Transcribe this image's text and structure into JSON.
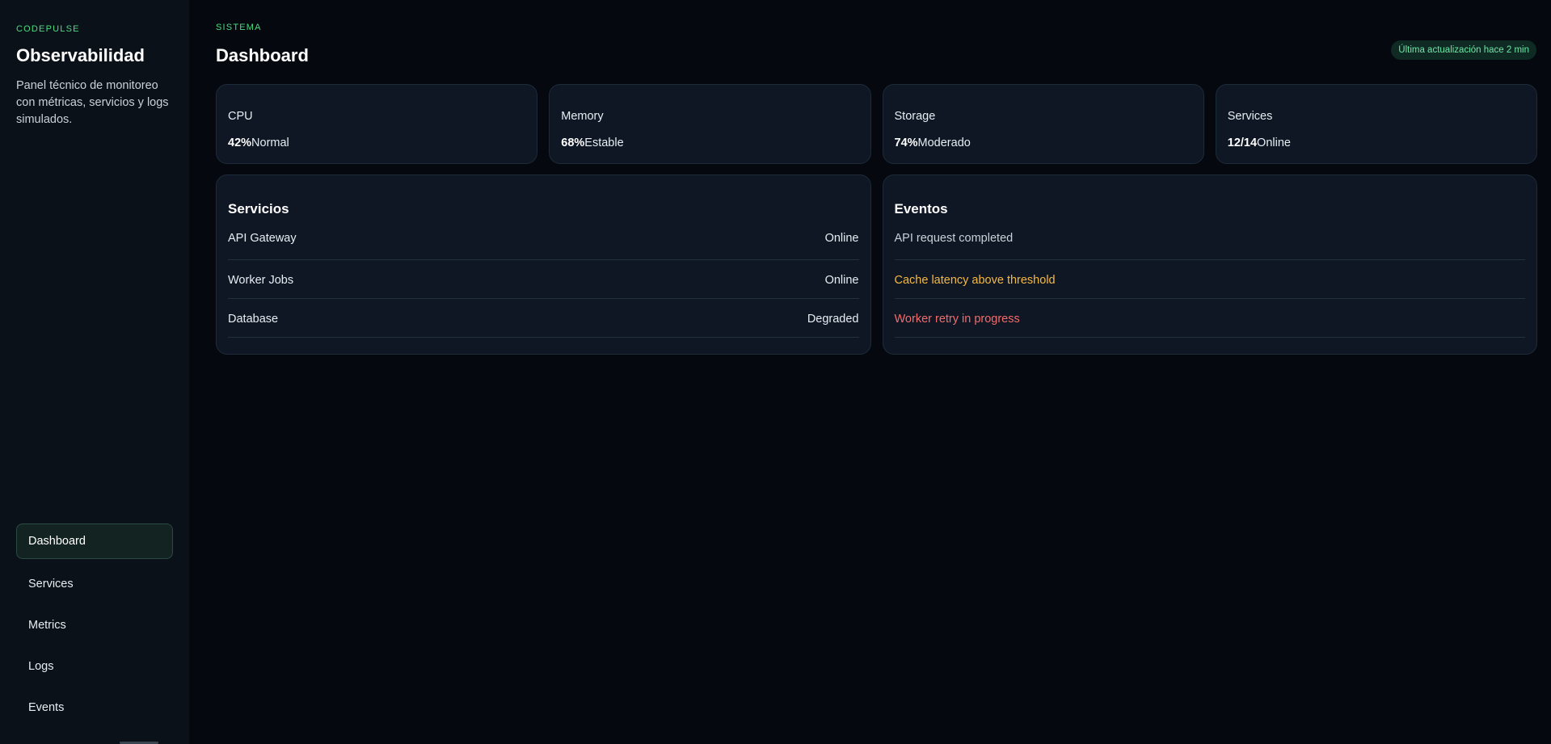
{
  "sidebar": {
    "brand_kicker": "CODEPULSE",
    "brand_title": "Observabilidad",
    "brand_desc": "Panel técnico de monitoreo con métricas, servicios y logs simulados.",
    "nav": [
      {
        "label": "Dashboard",
        "active": true
      },
      {
        "label": "Services",
        "active": false
      },
      {
        "label": "Metrics",
        "active": false
      },
      {
        "label": "Logs",
        "active": false
      },
      {
        "label": "Events",
        "active": false
      }
    ]
  },
  "header": {
    "kicker": "SISTEMA",
    "title": "Dashboard",
    "update_badge": "Última actualización hace 2 min"
  },
  "cards": [
    {
      "label": "CPU",
      "value": "42%",
      "status": "Normal"
    },
    {
      "label": "Memory",
      "value": "68%",
      "status": "Estable"
    },
    {
      "label": "Storage",
      "value": "74%",
      "status": "Moderado"
    },
    {
      "label": "Services",
      "value": "12/14",
      "status": "Online"
    }
  ],
  "services_panel": {
    "title": "Servicios",
    "rows": [
      {
        "name": "API Gateway",
        "status": "Online"
      },
      {
        "name": "Worker Jobs",
        "status": "Online"
      },
      {
        "name": "Database",
        "status": "Degraded"
      }
    ]
  },
  "events_panel": {
    "title": "Eventos",
    "rows": [
      {
        "text": "API request completed",
        "level": "ok"
      },
      {
        "text": "Cache latency above threshold",
        "level": "warn"
      },
      {
        "text": "Worker retry in progress",
        "level": "err"
      }
    ]
  },
  "colors": {
    "accent": "#4ade80",
    "warn": "#f5b942",
    "error": "#f26b6b",
    "background": "#05090f",
    "card": "#0f1724"
  }
}
